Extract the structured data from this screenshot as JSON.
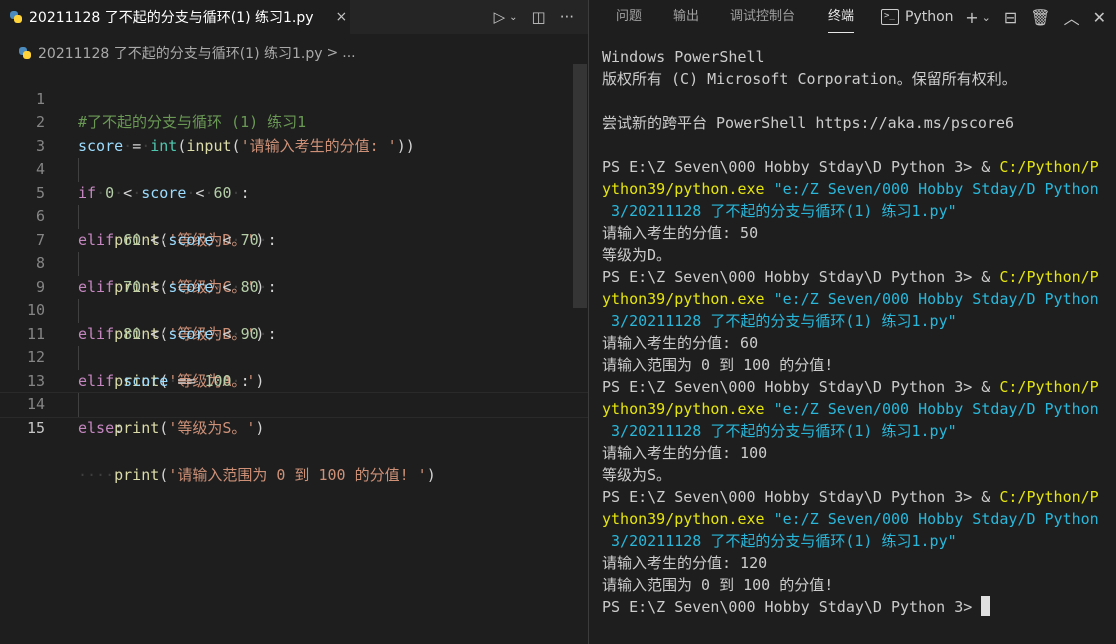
{
  "editor": {
    "tab_title": "20211128 了不起的分支与循环(1) 练习1.py",
    "tab_close": "×",
    "breadcrumb_file": "20211128 了不起的分支与循环(1) 练习1.py",
    "breadcrumb_sep": ">",
    "breadcrumb_more": "...",
    "active_line": 15,
    "lines": [
      {
        "n": "1"
      },
      {
        "n": "2"
      },
      {
        "n": "3"
      },
      {
        "n": "4"
      },
      {
        "n": "5"
      },
      {
        "n": "6"
      },
      {
        "n": "7"
      },
      {
        "n": "8"
      },
      {
        "n": "9"
      },
      {
        "n": "10"
      },
      {
        "n": "11"
      },
      {
        "n": "12"
      },
      {
        "n": "13"
      },
      {
        "n": "14"
      },
      {
        "n": "15"
      }
    ],
    "code": {
      "l1_comment": "#了不起的分支与循环 (1) 练习1",
      "l2_var": "score",
      "l2_eq": "=",
      "l2_int": "int",
      "l2_input": "input",
      "l2_str": "'请输入考生的分值: '",
      "kw_if": "if",
      "kw_elif": "elif",
      "kw_else": "else",
      "kw_print": "print",
      "var_score": "score",
      "op_lt": "<",
      "op_eq": "==",
      "n0": "0",
      "n60": "60",
      "n70": "70",
      "n80": "80",
      "n90": "90",
      "n100": "100",
      "s_d": "'等级为D。'",
      "s_c": "'等级为C。'",
      "s_b": "'等级为B。'",
      "s_a": "'等级为A。'",
      "s_s": "'等级为S。'",
      "s_range": "'请输入范围为 0 到 100 的分值! '"
    }
  },
  "panel": {
    "tabs": [
      "问题",
      "输出",
      "调试控制台",
      "终端"
    ],
    "active_tab": "终端",
    "terminal_select": "Python"
  },
  "terminal": {
    "lines": [
      {
        "t": "Windows PowerShell"
      },
      {
        "t": "版权所有 (C) Microsoft Corporation。保留所有权利。"
      },
      {
        "t": ""
      },
      {
        "t": "尝试新的跨平台 PowerShell https://aka.ms/pscore6"
      },
      {
        "t": ""
      },
      {
        "prompt": "PS E:\\Z Seven\\000 Hobby Stday\\D Python 3> ",
        "amp": "& ",
        "exe": "C:/Python/P"
      },
      {
        "exe": "ython39/python.exe",
        "arg": " \"e:/Z Seven/000 Hobby Stday/D Python"
      },
      {
        "arg": " 3/20211128 了不起的分支与循环(1) 练习1.py\""
      },
      {
        "t": "请输入考生的分值: 50"
      },
      {
        "t": "等级为D。"
      },
      {
        "prompt": "PS E:\\Z Seven\\000 Hobby Stday\\D Python 3> ",
        "amp": "& ",
        "exe": "C:/Python/P"
      },
      {
        "exe": "ython39/python.exe",
        "arg": " \"e:/Z Seven/000 Hobby Stday/D Python"
      },
      {
        "arg": " 3/20211128 了不起的分支与循环(1) 练习1.py\""
      },
      {
        "t": "请输入考生的分值: 60"
      },
      {
        "t": "请输入范围为 0 到 100 的分值!"
      },
      {
        "prompt": "PS E:\\Z Seven\\000 Hobby Stday\\D Python 3> ",
        "amp": "& ",
        "exe": "C:/Python/P"
      },
      {
        "exe": "ython39/python.exe",
        "arg": " \"e:/Z Seven/000 Hobby Stday/D Python"
      },
      {
        "arg": " 3/20211128 了不起的分支与循环(1) 练习1.py\""
      },
      {
        "t": "请输入考生的分值: 100"
      },
      {
        "t": "等级为S。"
      },
      {
        "prompt": "PS E:\\Z Seven\\000 Hobby Stday\\D Python 3> ",
        "amp": "& ",
        "exe": "C:/Python/P"
      },
      {
        "exe": "ython39/python.exe",
        "arg": " \"e:/Z Seven/000 Hobby Stday/D Python"
      },
      {
        "arg": " 3/20211128 了不起的分支与循环(1) 练习1.py\""
      },
      {
        "t": "请输入考生的分值: 120"
      },
      {
        "t": "请输入范围为 0 到 100 的分值!"
      },
      {
        "prompt": "PS E:\\Z Seven\\000 Hobby Stday\\D Python 3> ",
        "cursor": true
      }
    ]
  }
}
